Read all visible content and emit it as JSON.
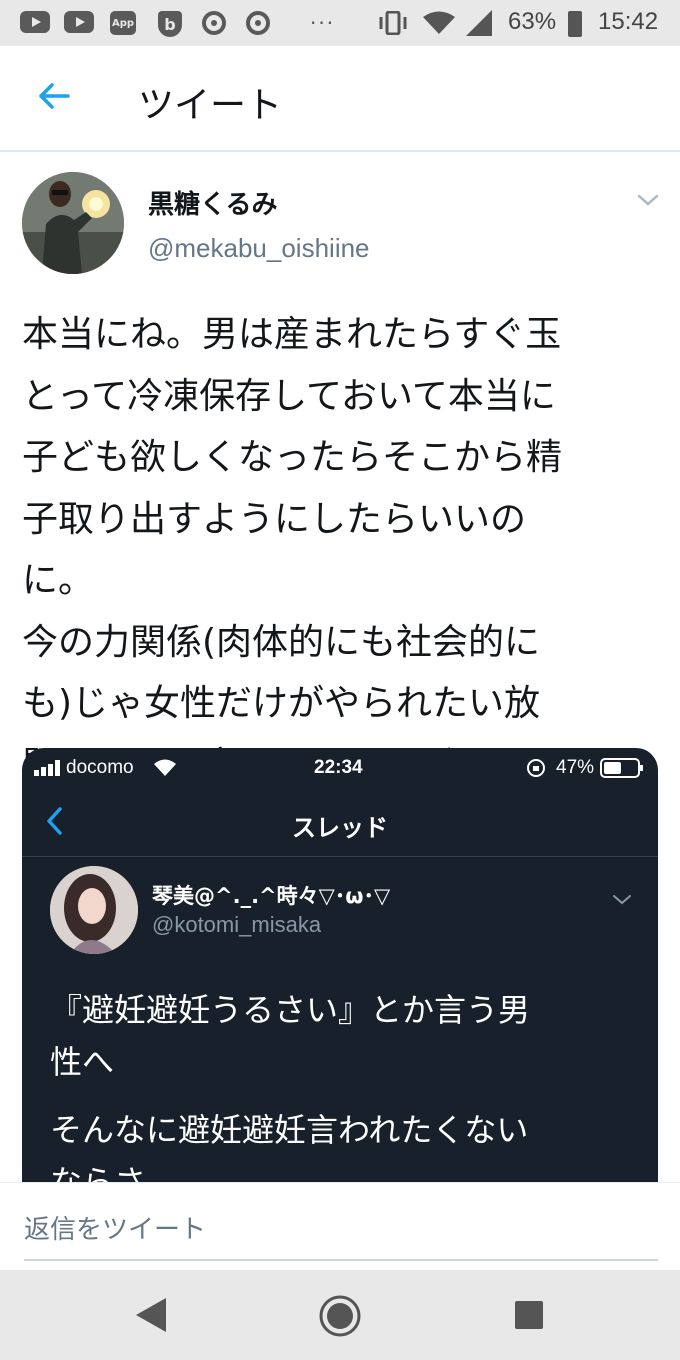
{
  "status_bar": {
    "app_icon_label": "App",
    "b_icon_label": "b",
    "more_dots": "···",
    "battery_percent": "63%",
    "time": "15:42",
    "icons": [
      "youtube-icon",
      "youtube-icon",
      "app-icon",
      "b-app-icon",
      "chrome-icon",
      "chrome-icon",
      "vibrate-icon",
      "wifi-icon",
      "signal-icon",
      "battery-icon"
    ]
  },
  "header": {
    "title": "ツイート",
    "back_icon": "back-arrow-icon",
    "accent_color": "#1da1f2"
  },
  "tweet": {
    "author": {
      "display_name": "黒糖くるみ",
      "username": "@mekabu_oishiine"
    },
    "text_lines": [
      "本当にね。男は産まれたらすぐ玉",
      "とって冷凍保存しておいて本当に",
      "子ども欲しくなったらそこから精",
      "子取り出すようにしたらいいの",
      "に。",
      "今の力関係(肉体的にも社会的に",
      "も)じゃ女性だけがやられたい放",
      "題やられて痛い思いするばかり。"
    ],
    "embedded_screenshot": {
      "carrier": "docomo",
      "time": "22:34",
      "battery": "47%",
      "nav_title": "スレッド",
      "author_name": "琴美@^._.^時々▽･ω･▽",
      "author_username": "@kotomi_misaka",
      "text_lines": [
        "『避妊避妊うるさい』とか言う男",
        "性へ",
        "そんなに避妊避妊言われたくない",
        "ならさ"
      ],
      "background_color": "#17202b"
    }
  },
  "reply": {
    "placeholder": "返信をツイート"
  },
  "nav_bar": {
    "icons": [
      "back-triangle-icon",
      "home-circle-icon",
      "recents-square-icon"
    ]
  }
}
